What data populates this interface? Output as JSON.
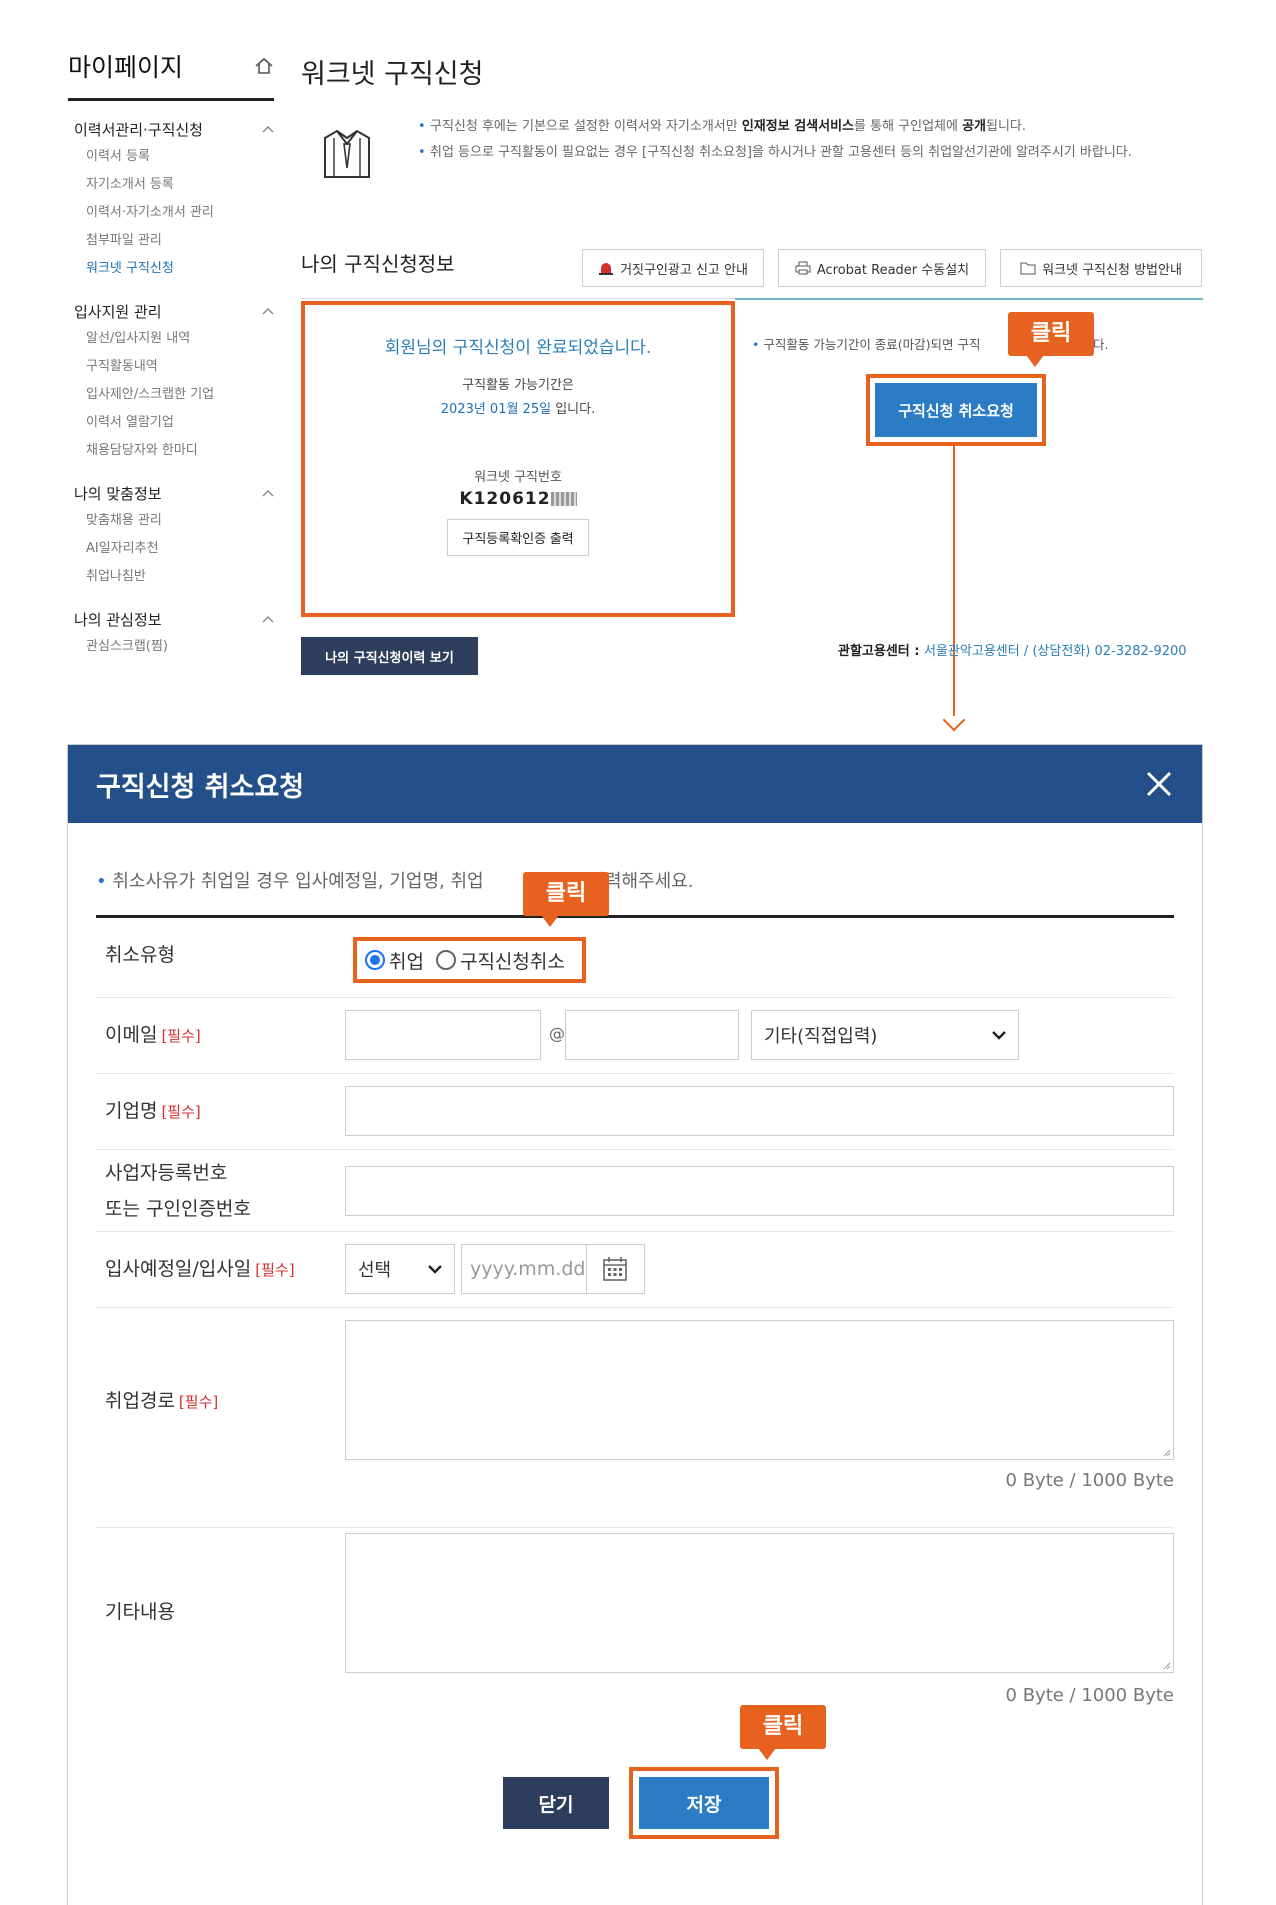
{
  "sidebar": {
    "title": "마이페이지",
    "groups": [
      {
        "label": "이력서관리·구직신청",
        "items": [
          "이력서 등록",
          "자기소개서 등록",
          "이력서·자기소개서 관리",
          "첨부파일 관리",
          "워크넷 구직신청"
        ]
      },
      {
        "label": "입사지원 관리",
        "items": [
          "알선/입사지원 내역",
          "구직활동내역",
          "입사제안/스크랩한 기업",
          "이력서 열람기업",
          "채용담당자와 한마디"
        ]
      },
      {
        "label": "나의 맞춤정보",
        "items": [
          "맞춤채용 관리",
          "AI일자리추천",
          "취업나침반"
        ]
      },
      {
        "label": "나의 관심정보",
        "items": [
          "관심스크랩(찜)"
        ]
      }
    ]
  },
  "page": {
    "title": "워크넷 구직신청",
    "notice1_a": "구직신청 후에는 기본으로 설정한 이력서와 자기소개서만 ",
    "notice1_b": "인재정보 검색서비스",
    "notice1_c": "를 통해 구인업체에 ",
    "notice1_d": "공개",
    "notice1_e": "됩니다.",
    "notice2": "취업 등으로 구직활동이 필요없는 경우 [구직신청 취소요청]을 하시거나 관할 고용센터 등의 취업알선기관에 알려주시기 바랍니다."
  },
  "section": {
    "title": "나의 구직신청정보",
    "buttons": [
      "거짓구인광고 신고 안내",
      "Acrobat Reader 수동설치",
      "워크넷 구직신청 방법안내"
    ]
  },
  "status": {
    "message": "회원님의 구직신청이 완료되었습니다.",
    "period_label": "구직활동 가능기간은",
    "period_date": "2023년 01월 25일",
    "period_suffix": " 입니다.",
    "jobno_label": "워크넷 구직번호",
    "jobno": "K120612",
    "print_button": "구직등록확인증 출력"
  },
  "right": {
    "note": "구직활동 가능기간이 종료(마감)되면 구직",
    "note_tail": "야 합니다.",
    "cancel_button": "구직신청 취소요청"
  },
  "history_button": "나의 구직신청이력 보기",
  "office": {
    "label": "관할고용센터 : ",
    "value": "서울관악고용센터 / (상담전화) 02-3282-9200"
  },
  "callout": "클릭",
  "modal": {
    "title": "구직신청 취소요청",
    "notice_a": "취소사유가 취업일 경우 입사예정일, 기업명, 취업",
    "notice_b": "드시 입력해주세요.",
    "required": "[필수]",
    "fields": {
      "cancel_type": "취소유형",
      "radio_employed": "취업",
      "radio_cancel": "구직신청취소",
      "email": "이메일",
      "email_at": "@",
      "email_domain": "기타(직접입력)",
      "company": "기업명",
      "bizno_1": "사업자등록번호",
      "bizno_2": "또는 구인인증번호",
      "join_date": "입사예정일/입사일",
      "join_select": "선택",
      "join_placeholder": "yyyy.mm.dd",
      "path": "취업경로",
      "etc": "기타내용"
    },
    "byte_counter": "0 Byte / 1000 Byte",
    "close_button": "닫기",
    "save_button": "저장"
  },
  "colors": {
    "accent": "#e8621f",
    "primary": "#2c7bc5",
    "header": "#24508a",
    "navy": "#2c3e5c"
  }
}
